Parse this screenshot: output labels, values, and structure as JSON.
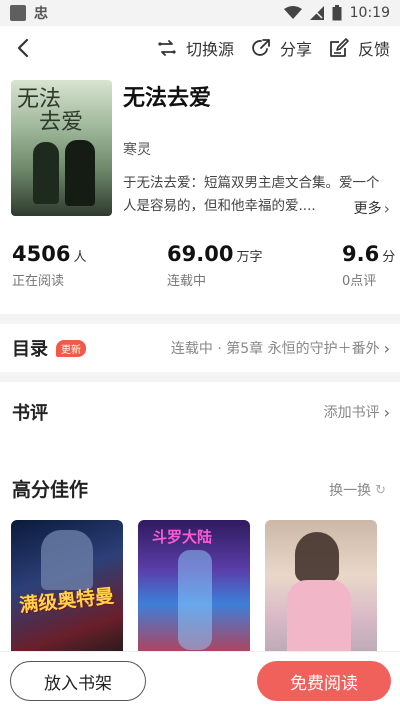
{
  "status_bar": {
    "app_glyph": "忠",
    "time": "10:19"
  },
  "top_bar": {
    "actions": [
      {
        "label": "切换源",
        "icon": "switch-source-icon"
      },
      {
        "label": "分享",
        "icon": "share-icon"
      },
      {
        "label": "反馈",
        "icon": "feedback-icon"
      }
    ]
  },
  "book": {
    "cover_title_line1": "无法",
    "cover_title_line2": "去爱",
    "title": "无法去爱",
    "author": "寒灵",
    "description": "于无法去爱：短篇双男主虐文合集。爱一个人是容易的，但和他幸福的爱....",
    "more_label": "更多"
  },
  "stats": {
    "readers": {
      "value": "4506",
      "unit": "人",
      "label": "正在阅读"
    },
    "words": {
      "value": "69.00",
      "unit": "万字",
      "label": "连载中"
    },
    "score": {
      "value": "9.6",
      "unit": "分",
      "label": "0点评"
    }
  },
  "catalog": {
    "title": "目录",
    "badge": "更新",
    "status": "连载中 · 第5章 永恒的守护＋番外"
  },
  "reviews": {
    "title": "书评",
    "action": "添加书评"
  },
  "recommend": {
    "title": "高分佳作",
    "refresh_label": "换一换",
    "cards": [
      {
        "text": "满级奥特曼"
      },
      {
        "text": "斗罗大陆"
      },
      {
        "text": ""
      }
    ]
  },
  "bottom": {
    "shelf_label": "放入书架",
    "read_label": "免费阅读"
  },
  "colors": {
    "accent": "#f0615b",
    "badge": "#f15a4a"
  }
}
